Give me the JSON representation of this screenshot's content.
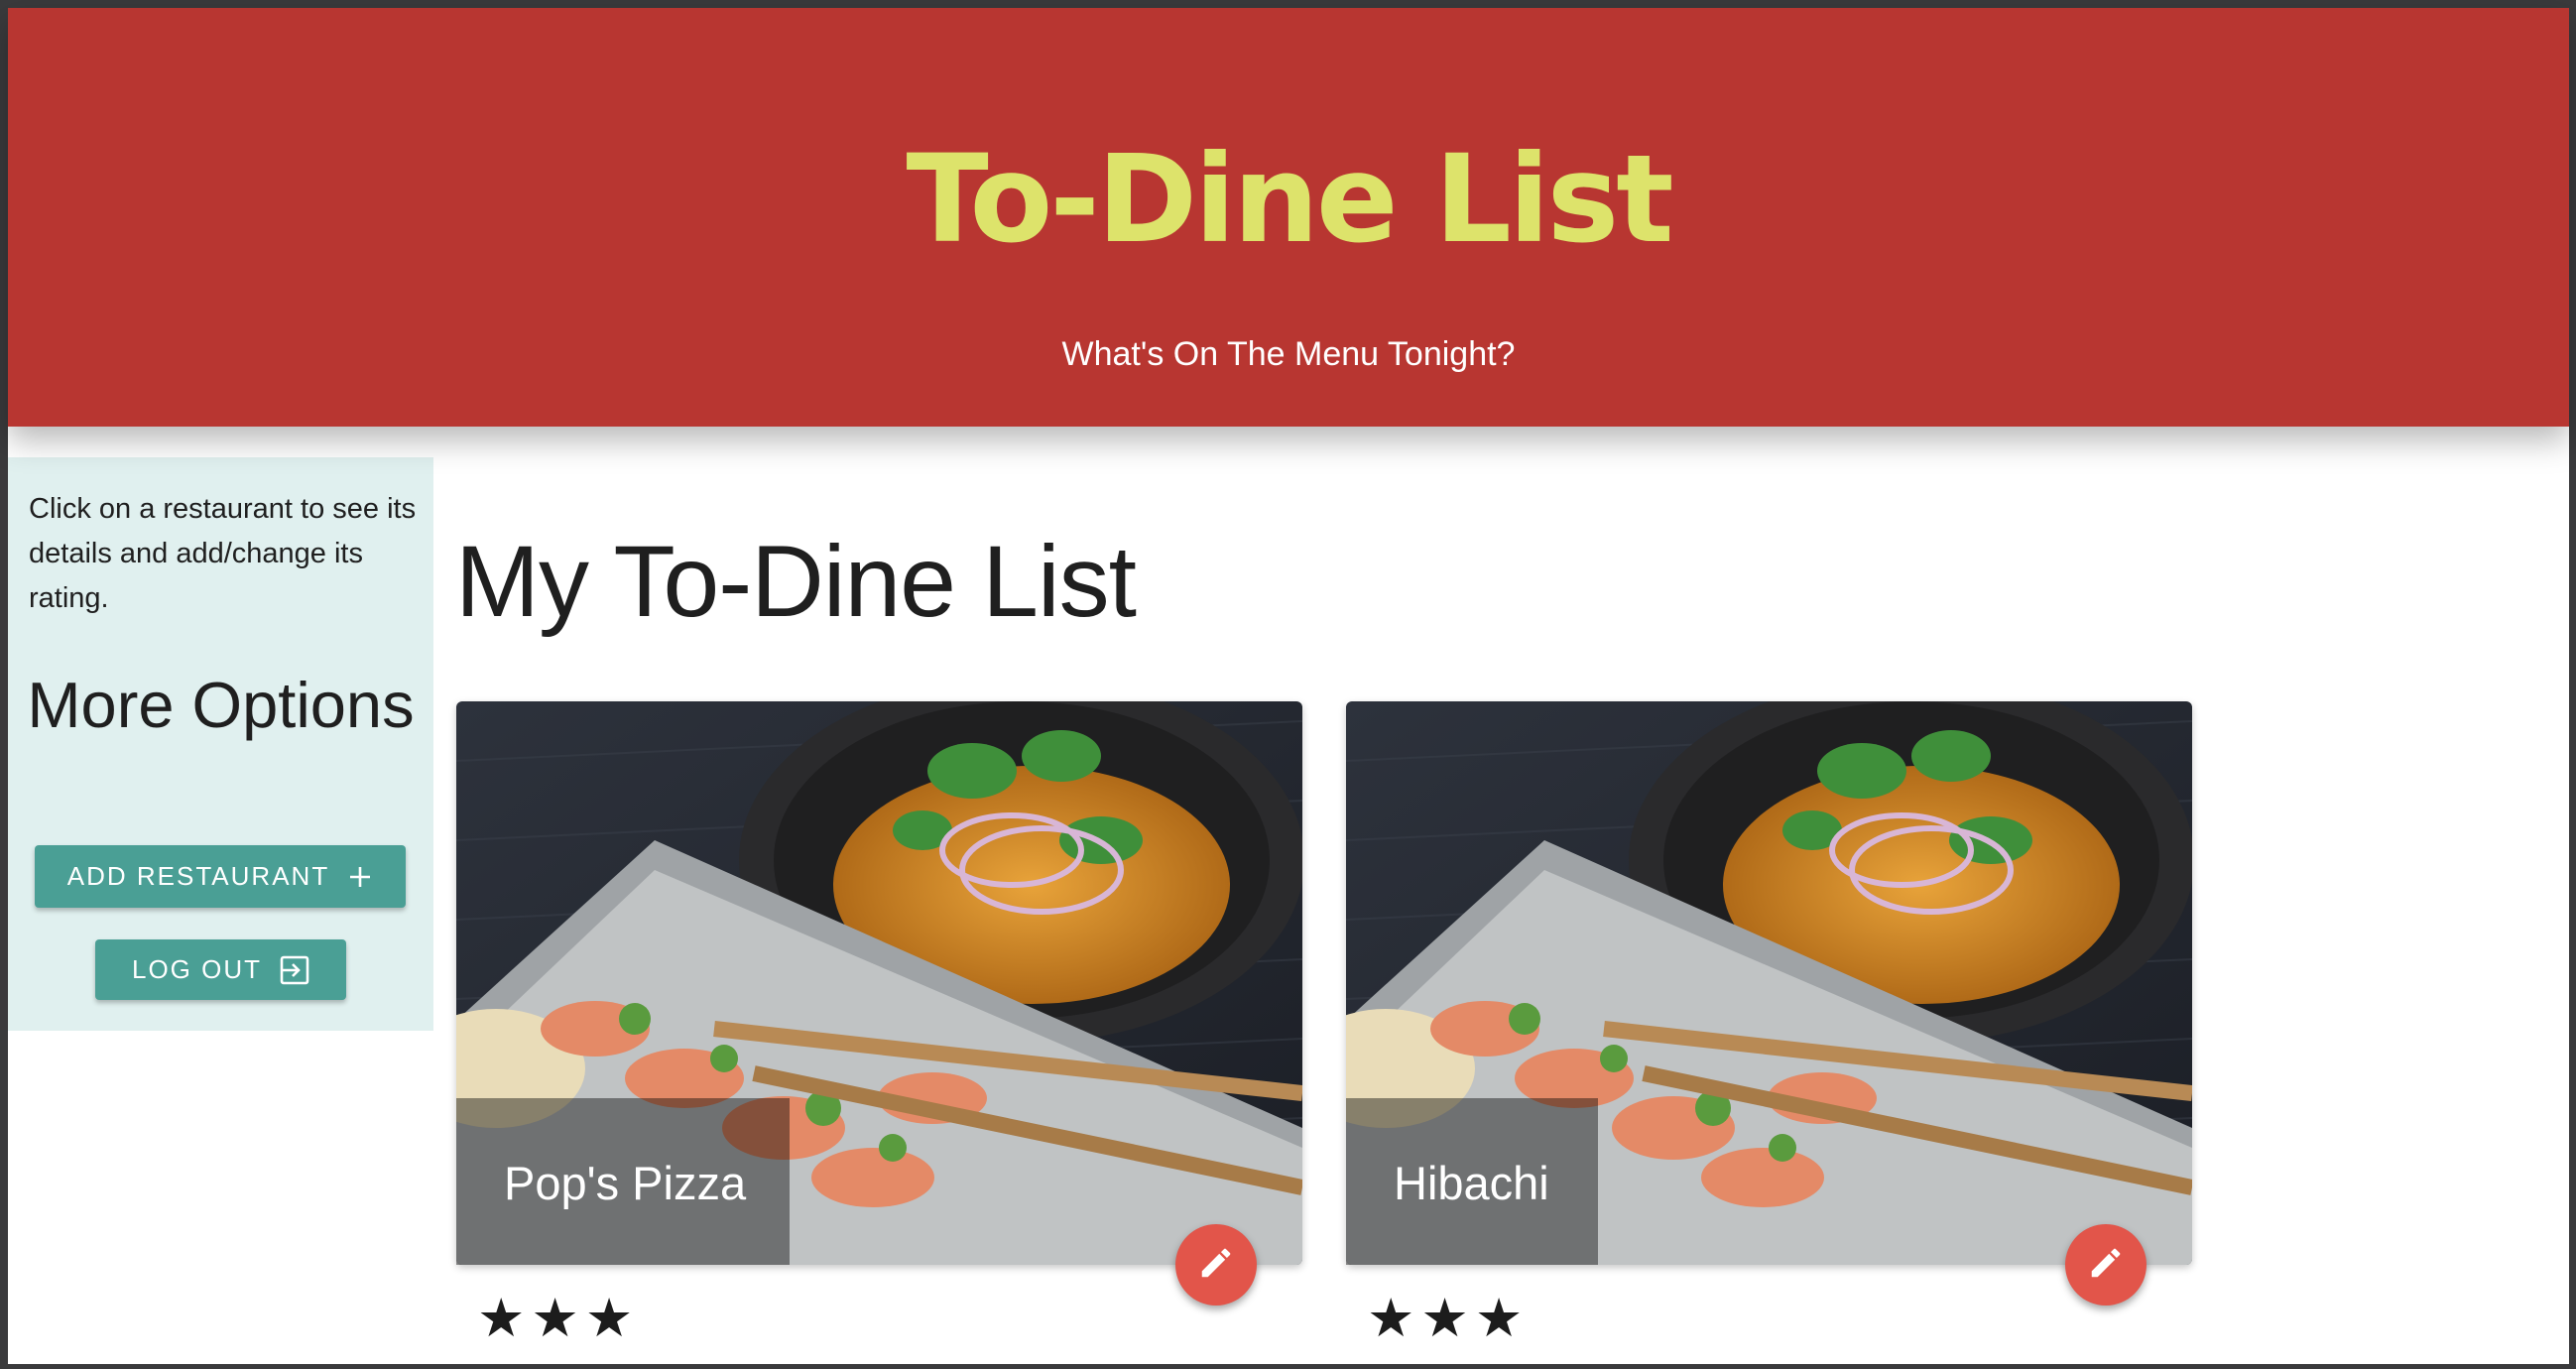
{
  "header": {
    "title": "To-Dine List",
    "subtitle": "What's On The Menu Tonight?",
    "background_color": "#b83631",
    "title_color": "#dde36b"
  },
  "sidebar": {
    "help_text": "Click on a restaurant to see its details and add/change its rating.",
    "heading": "More Options",
    "add_button": {
      "label": "ADD RESTAURANT",
      "icon": "plus-icon"
    },
    "logout_button": {
      "label": "LOG OUT",
      "icon": "logout-icon"
    },
    "background_color": "#e0f0ef",
    "button_color": "#4a9f95"
  },
  "main": {
    "title": "My To-Dine List",
    "restaurants": [
      {
        "name": "Pop's Pizza",
        "stars": 3,
        "edit_icon": "pencil-icon"
      },
      {
        "name": "Hibachi",
        "stars": 3,
        "edit_icon": "pencil-icon"
      }
    ],
    "fab_color": "#e2554a"
  }
}
